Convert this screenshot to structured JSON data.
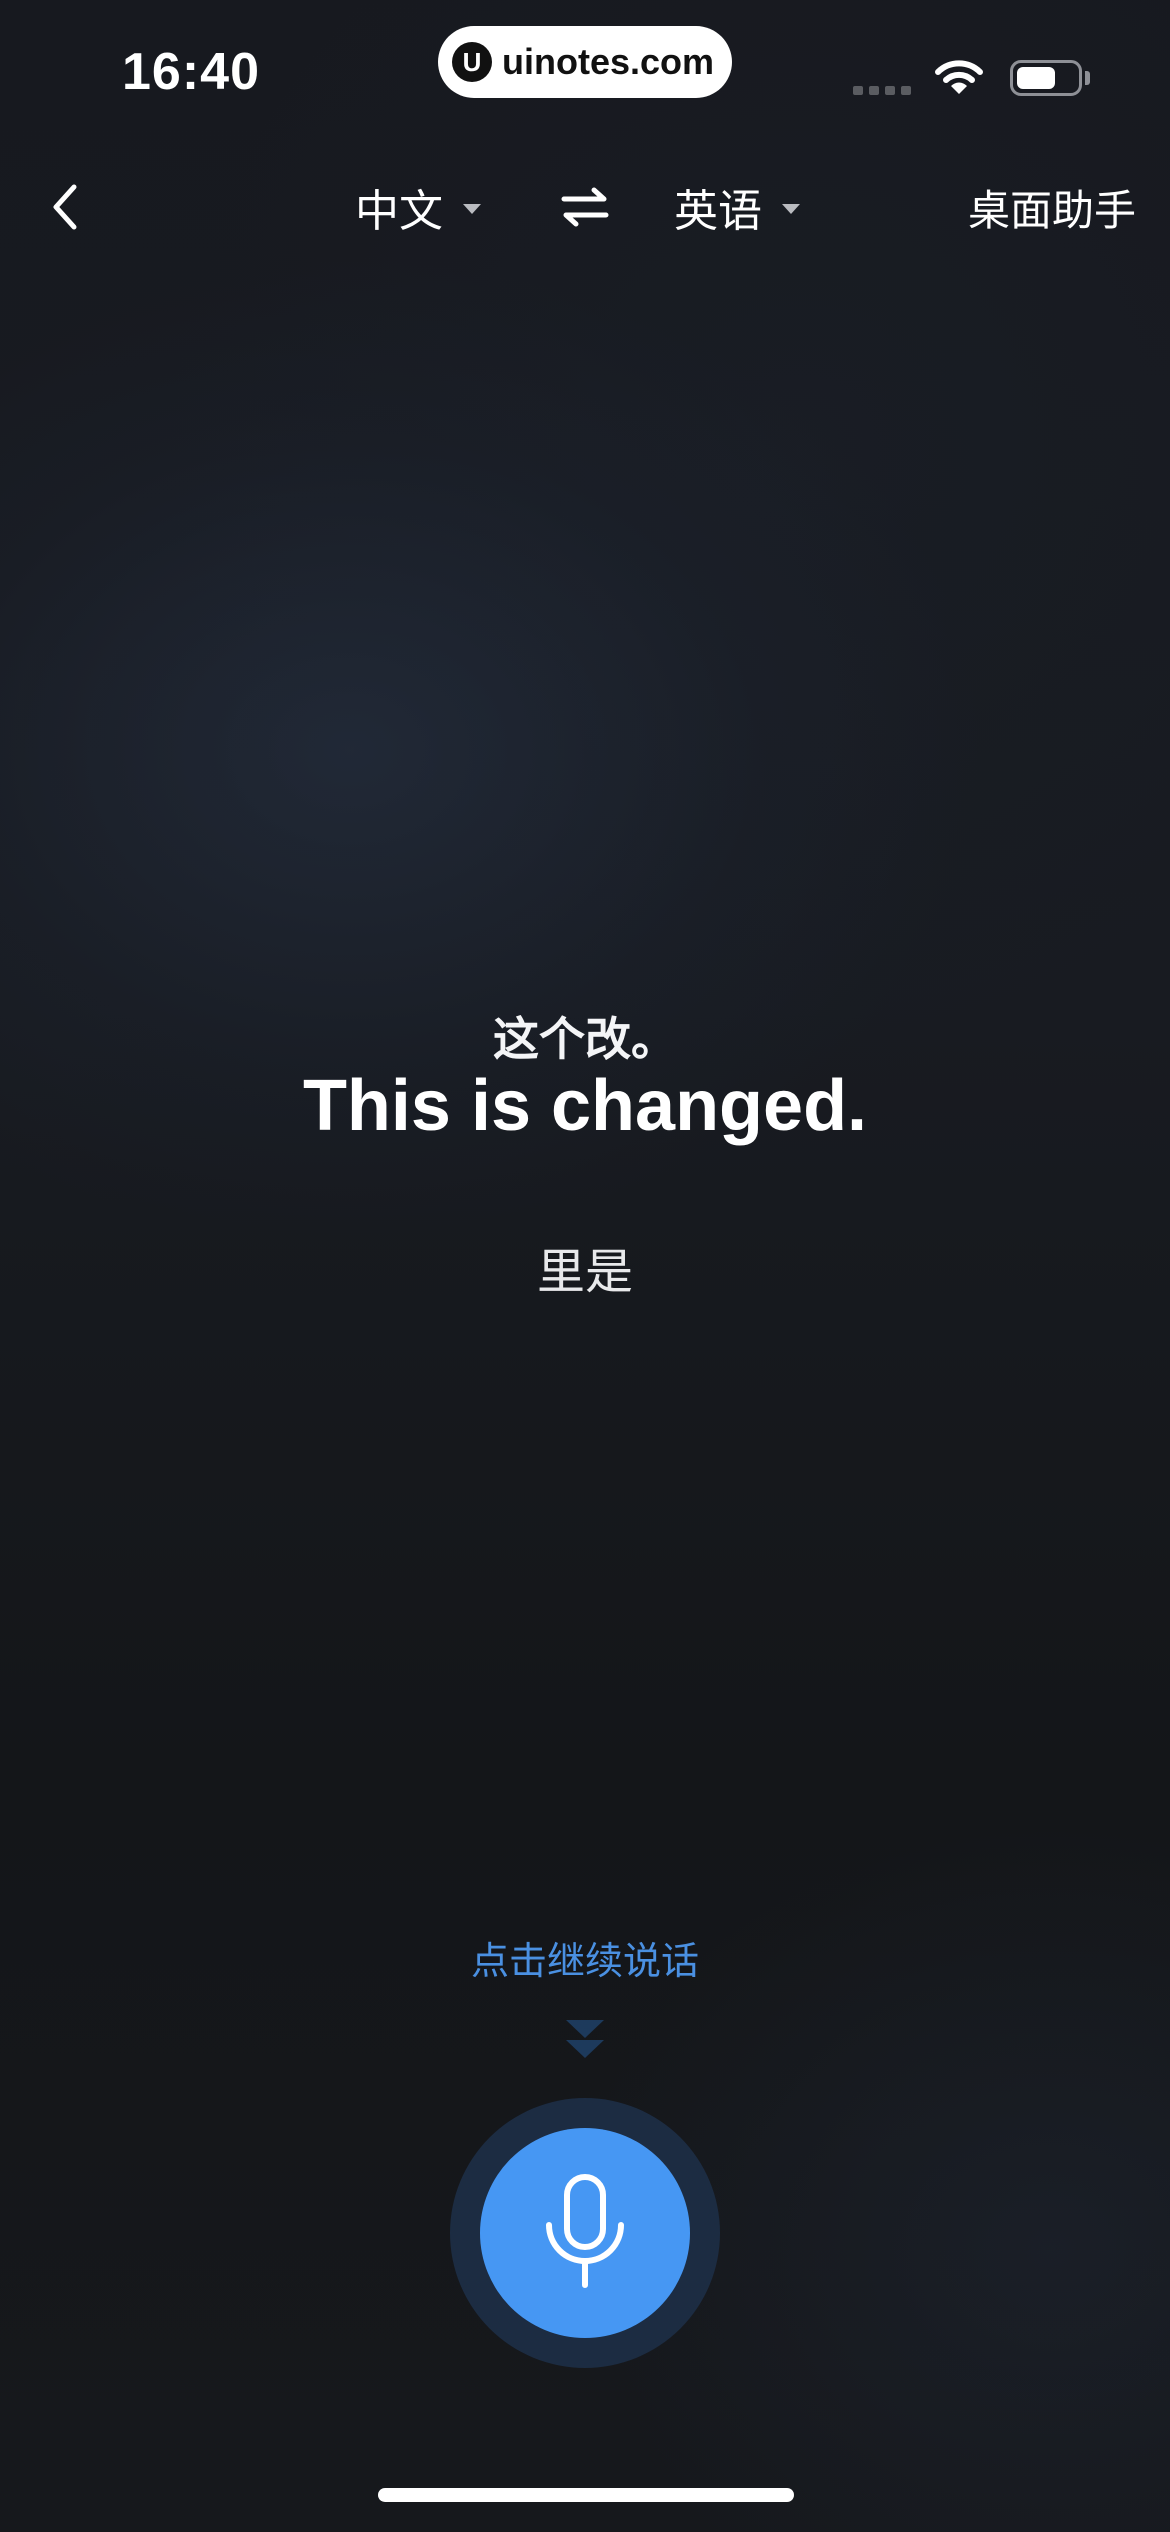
{
  "status_bar": {
    "time": "16:40",
    "site_label": "uinotes.com",
    "site_logo_letter": "U",
    "battery_level": 0.65,
    "icons": [
      "signal-icon",
      "wifi-icon",
      "battery-icon"
    ]
  },
  "nav": {
    "back_icon": "chevron-left-icon",
    "source_language": "中文",
    "swap_icon": "swap-arrows-icon",
    "target_language": "英语",
    "desktop_assistant": "桌面助手"
  },
  "transcript": {
    "source_text": "这个改。",
    "translation_text": "This is changed.",
    "partial_text": "里是"
  },
  "footer": {
    "hint": "点击继续说话",
    "mic_icon": "microphone-icon"
  },
  "colors": {
    "accent": "#4697f3",
    "hint": "#4a90e2",
    "mic_ring": "#1c2c42",
    "background": "#15171b"
  }
}
